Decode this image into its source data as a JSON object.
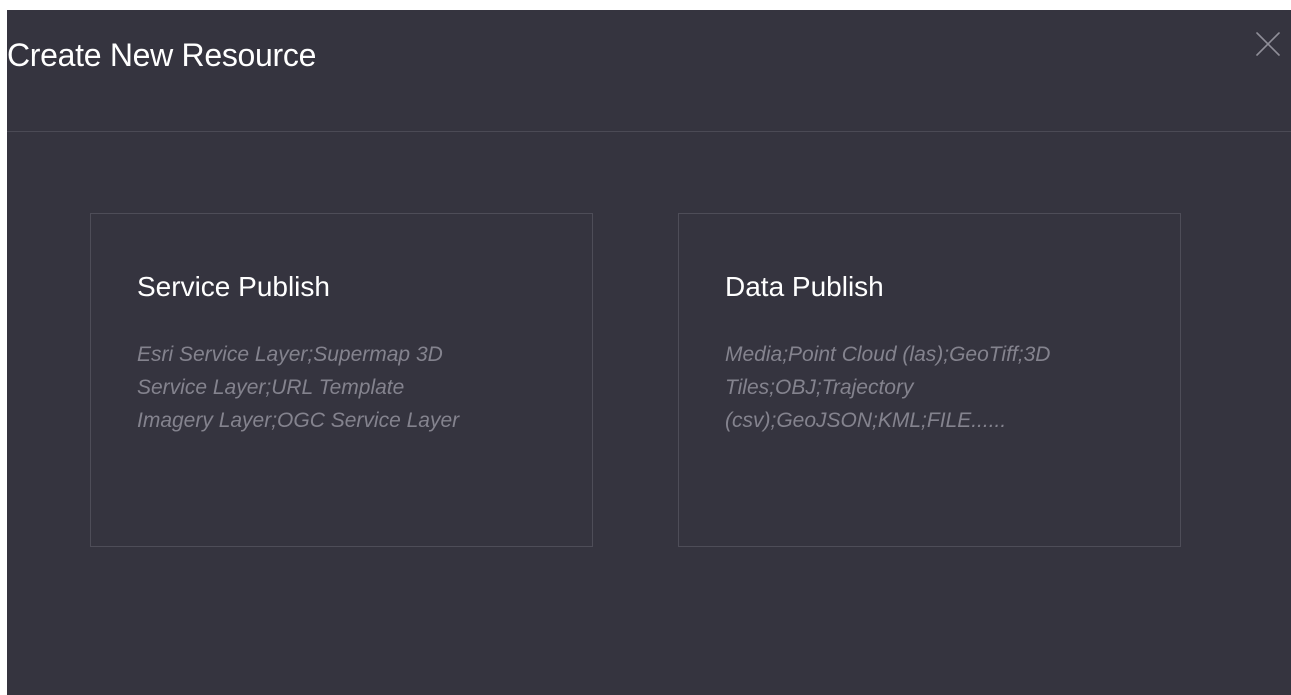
{
  "dialog": {
    "title": "Create New Resource",
    "close_icon": "close-icon"
  },
  "cards": [
    {
      "title": "Service Publish",
      "description_lines": [
        "Esri Service Layer;Supermap 3D",
        "Service Layer;URL Template",
        "Imagery Layer;OGC Service Layer"
      ]
    },
    {
      "title": "Data Publish",
      "description_lines": [
        "Media;Point Cloud (las);GeoTiff;3D",
        "Tiles;OBJ;Trajectory",
        "(csv);GeoJSON;KML;FILE......"
      ]
    }
  ],
  "colors": {
    "dialog_background": "#35343f",
    "title_text": "#ffffff",
    "description_text": "#84838e",
    "card_border": "#4e4d58",
    "close_icon": "#8f8e98"
  }
}
